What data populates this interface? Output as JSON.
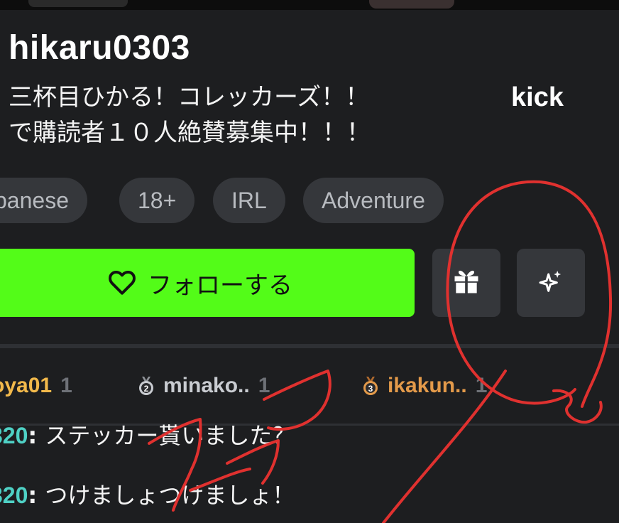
{
  "channel": {
    "username": "hikaru0303",
    "bio_lines": [
      "三杯目ひかる！コレッカーズ！！",
      "で購読者１０人絶賛募集中！！！"
    ],
    "platform_label": "kick"
  },
  "tags": [
    "panese",
    "18+",
    "IRL",
    "Adventure"
  ],
  "actions": {
    "follow_label": "フォローする",
    "follow_color": "#53fc18",
    "gift_icon": "gift-icon",
    "sparkle_icon": "sparkle-icon"
  },
  "leaderboard": [
    {
      "name": "oya01",
      "count": "1",
      "rank": "1",
      "name_color": "#f2b94b",
      "badge": "gold"
    },
    {
      "name": "minako..",
      "count": "1",
      "rank": "2",
      "name_color": "#c9ccd1",
      "badge": "silver"
    },
    {
      "name": "ikakun..",
      "count": "1",
      "rank": "3",
      "name_color": "#e39a4a",
      "badge": "bronze"
    }
  ],
  "chat": [
    {
      "user": "320",
      "message": "ステッカー貰いました？"
    },
    {
      "user": "320",
      "message": "つけましょつけましょ！"
    }
  ],
  "annotation": {
    "color": "#e0312f",
    "description": "hand-drawn red circle and scribbles"
  }
}
